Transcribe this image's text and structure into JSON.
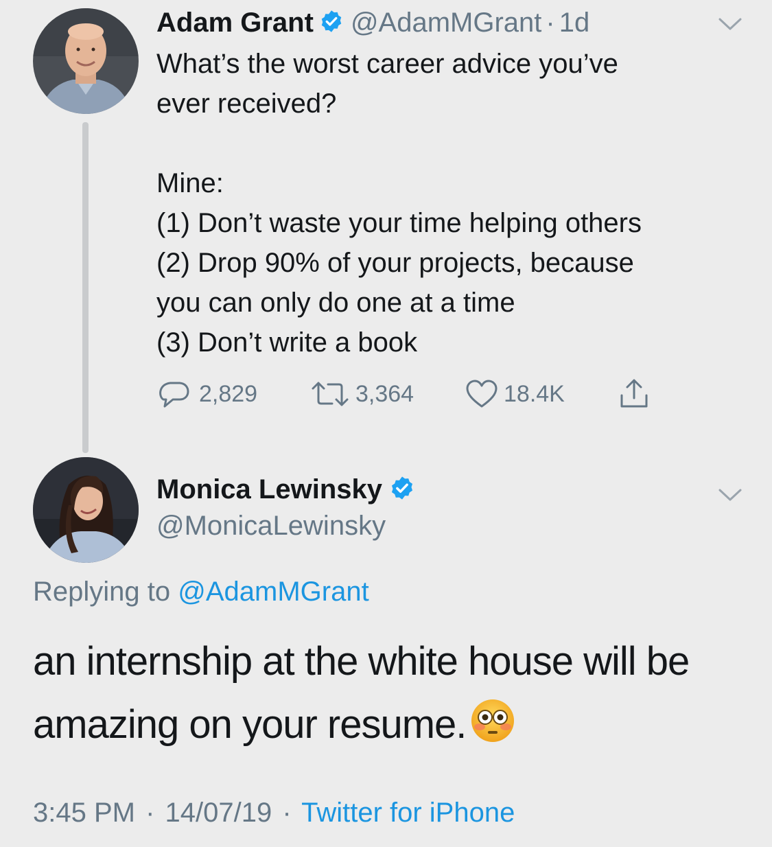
{
  "tweet": {
    "author_name": "Adam Grant",
    "author_handle": "@AdamMGrant",
    "separator": "·",
    "age": "1d",
    "text": "What’s the worst career advice you’ve\never received?\n\nMine:\n(1) Don’t waste your time helping others\n(2) Drop 90% of your projects, because\nyou can only do one at a time\n(3) Don’t write a book",
    "actions": {
      "replies": "2,829",
      "retweets": "3,364",
      "likes": "18.4K"
    },
    "icons": {
      "verified": "verified-badge-icon",
      "menu": "chevron-down-icon",
      "reply": "reply-icon",
      "retweet": "retweet-icon",
      "like": "heart-icon",
      "share": "share-icon"
    }
  },
  "reply": {
    "author_name": "Monica Lewinsky",
    "author_handle": "@MonicaLewinsky",
    "replying_prefix": "Replying to",
    "replying_to": "@AdamMGrant",
    "text": "an internship at the white house will be amazing on your resume.",
    "emoji": "flushed-face-emoji",
    "time": "3:45 PM",
    "date": "14/07/19",
    "separator": "·",
    "source": "Twitter for iPhone"
  },
  "colors": {
    "background": "#ececec",
    "text": "#14171a",
    "secondary": "#657786",
    "link": "#1b95e0",
    "verified": "#1da1f2"
  }
}
